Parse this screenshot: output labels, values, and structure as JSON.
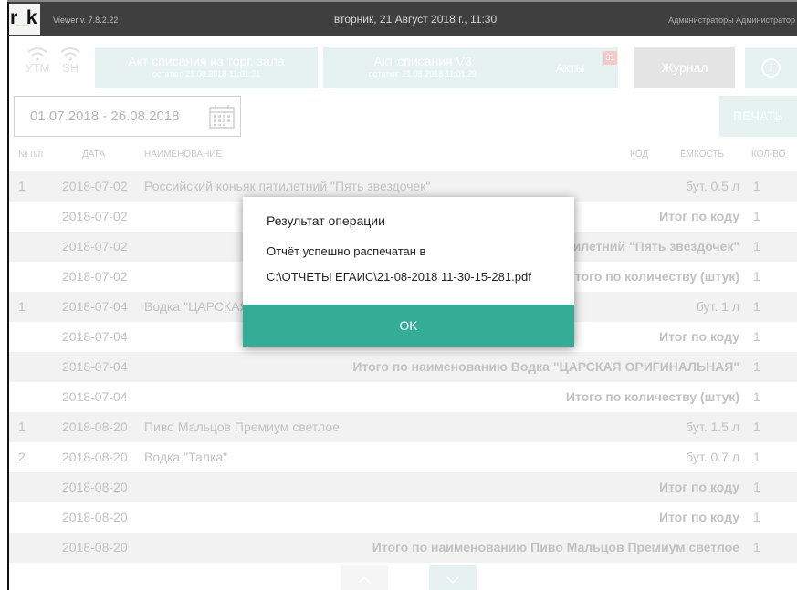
{
  "app": {
    "logo": "r_k",
    "logo_prefix": "r",
    "logo_underscore": "_",
    "logo_suffix": "k",
    "version": "Viewer v. 7.8.2.22",
    "datetime": "вторник, 21 Август 2018 г., 11:30",
    "user": "Администраторы Администратор"
  },
  "status": {
    "utm_label": "УТМ",
    "sh_label": "SH",
    "icon": "wifi-icon"
  },
  "toolbar": {
    "btn_act_hall": {
      "title": "Акт списания из торг. зала",
      "sub": "остатки: 21.08.2018 11:01:31"
    },
    "btn_act_v3": {
      "title": "Акт списания V3",
      "sub": "остатки: 21.08.2018 11:01:29"
    },
    "btn_acts": {
      "title": "Акты",
      "badge": "31"
    },
    "btn_journal": {
      "title": "Журнал"
    },
    "info_icon": "info-icon",
    "info_glyph": "i"
  },
  "filter": {
    "date_range": "01.07.2018 - 26.08.2018",
    "calendar_icon": "calendar-icon",
    "print_label": "ПЕЧАТЬ"
  },
  "table": {
    "columns": {
      "num": "№ п/п",
      "date": "ДАТА",
      "name": "НАИМЕНОВАНИЕ",
      "code": "КОД",
      "volume": "ЕМКОСТЬ",
      "qty": "КОЛ-ВО"
    },
    "rows": [
      {
        "num": "1",
        "date": "2018-07-02",
        "name": "Российский коньяк пятилетний \"Пять звездочек\"",
        "right": "бут. 0.5 л",
        "qty": "1"
      },
      {
        "num": "",
        "date": "2018-07-02",
        "name": "",
        "right": "Итог по коду",
        "qty": "1"
      },
      {
        "num": "",
        "date": "2018-07-02",
        "name": "",
        "right": "Итого по наименованию Российский коньяк пятилетний \"Пять звездочек\"",
        "qty": "1"
      },
      {
        "num": "",
        "date": "2018-07-02",
        "name": "",
        "right": "Итого по количеству (штук)",
        "qty": "1"
      },
      {
        "num": "1",
        "date": "2018-07-04",
        "name": "Водка \"ЦАРСКАЯ ОРИГИНАЛЬНАЯ\"",
        "right": "бут. 1 л",
        "qty": "1"
      },
      {
        "num": "",
        "date": "2018-07-04",
        "name": "",
        "right": "Итог по коду",
        "qty": "1"
      },
      {
        "num": "",
        "date": "2018-07-04",
        "name": "",
        "right": "Итого по наименованию Водка \"ЦАРСКАЯ ОРИГИНАЛЬНАЯ\"",
        "qty": "1"
      },
      {
        "num": "",
        "date": "2018-07-04",
        "name": "",
        "right": "Итого по количеству (штук)",
        "qty": "1"
      },
      {
        "num": "1",
        "date": "2018-08-20",
        "name": "Пиво Мальцов Премиум светлое",
        "right": "бут. 1.5 л",
        "qty": "1"
      },
      {
        "num": "2",
        "date": "2018-08-20",
        "name": "Водка \"Талка\"",
        "right": "бут. 0.7 л",
        "qty": "1"
      },
      {
        "num": "",
        "date": "2018-08-20",
        "name": "",
        "right": "Итог по коду",
        "qty": "1"
      },
      {
        "num": "",
        "date": "2018-08-20",
        "name": "",
        "right": "Итог по коду",
        "qty": "1"
      },
      {
        "num": "",
        "date": "2018-08-20",
        "name": "",
        "right": "Итого по наименованию Пиво Мальцов Премиум светлое",
        "qty": "1"
      }
    ]
  },
  "pager": {
    "up_icon": "chevron-up-icon",
    "down_icon": "chevron-down-icon"
  },
  "dialog": {
    "title": "Результат операции",
    "message_line1": "Отчёт успешно распечатан в",
    "message_line2": "C:\\ОТЧЕТЫ ЕГАИС\\21-08-2018 11-30-15-281.pdf",
    "ok_label": "OK"
  },
  "colors": {
    "accent": "#33ad96",
    "accent_faded": "#e6f2ef",
    "titlebar": "#3f3f3f",
    "badge": "#f6c9c9",
    "logo_underscore": "#6bbf2a"
  }
}
